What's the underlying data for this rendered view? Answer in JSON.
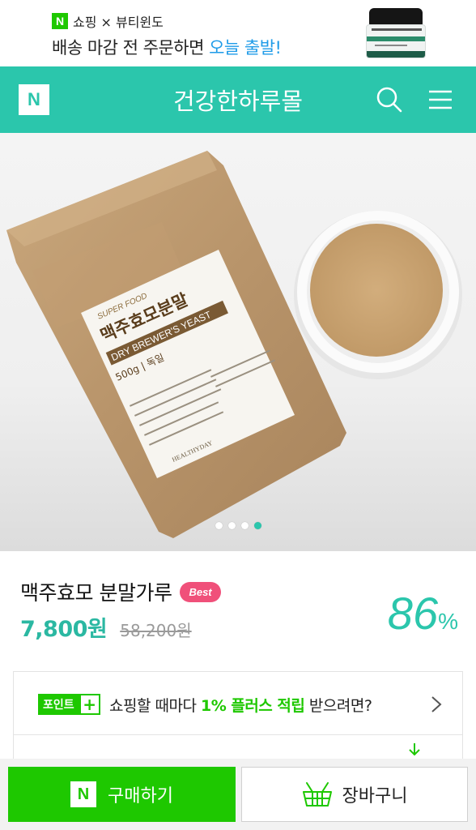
{
  "promo": {
    "badge": "N",
    "line1": "쇼핑 × 뷰티윈도",
    "line2_prefix": "배송 마감 전 주문하면 ",
    "line2_highlight": "오늘 출발!"
  },
  "header": {
    "logo": "N",
    "title": "건강한하루몰",
    "search_icon": "search-icon",
    "menu_icon": "hamburger-menu-icon",
    "bg_color": "#2bc6ac"
  },
  "hero": {
    "package_label_top": "SUPER FOOD",
    "package_label_main": "맥주효모분말",
    "package_label_sub": "DRY BREWER'S YEAST",
    "package_label_weight": "500g | 독일",
    "package_brand": "HEALTHYDAY",
    "carousel": {
      "count": 4,
      "active_index": 3
    }
  },
  "product": {
    "name": "맥주효모 분말가루",
    "badge": "Best",
    "price": "7,800원",
    "original_price": "58,200원",
    "discount_value": "86",
    "discount_unit": "%"
  },
  "point_banner": {
    "tag_label": "포인트",
    "tag_plus": "+",
    "text_prefix": "쇼핑할 때마다 ",
    "text_highlight": "1% 플러스 적립",
    "text_suffix": " 받으려면?"
  },
  "bottom_bar": {
    "buy_logo": "N",
    "buy_label": "구매하기",
    "cart_label": "장바구니",
    "buy_color": "#1ec800"
  }
}
